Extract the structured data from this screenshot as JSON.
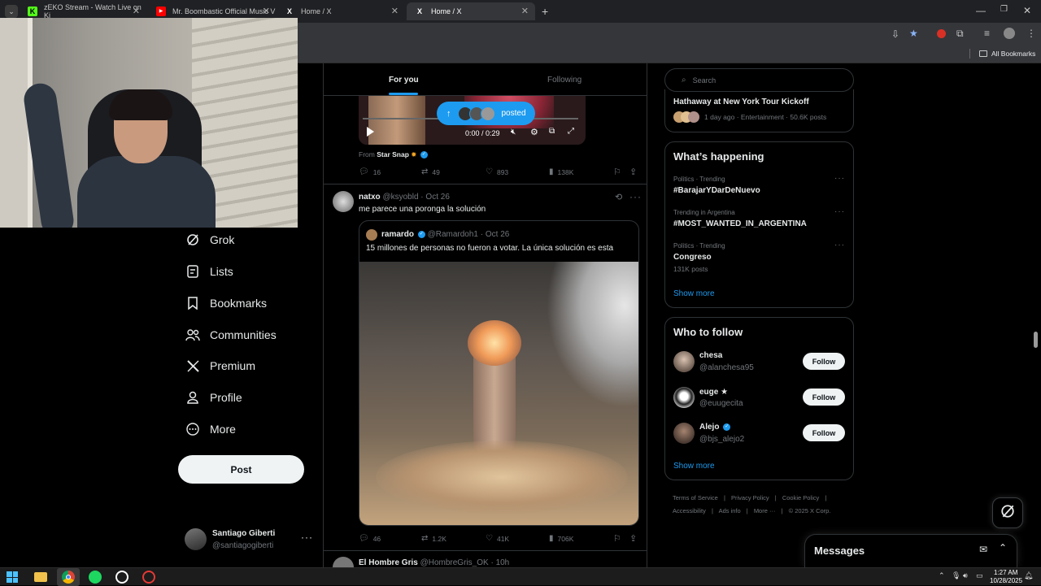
{
  "browser": {
    "tabs": [
      {
        "title": "zEKO Stream - Watch Live on Ki",
        "favicon": "K"
      },
      {
        "title": "Mr. Boombastic Official Music V",
        "favicon": "▶"
      },
      {
        "title": "Home / X",
        "favicon": "X"
      },
      {
        "title": "Home / X",
        "favicon": "X"
      }
    ],
    "all_bookmarks": "All Bookmarks"
  },
  "nav": {
    "items": [
      {
        "label": "Grok",
        "icon": "grok-icon"
      },
      {
        "label": "Lists",
        "icon": "lists-icon"
      },
      {
        "label": "Bookmarks",
        "icon": "bookmark-icon"
      },
      {
        "label": "Communities",
        "icon": "communities-icon"
      },
      {
        "label": "Premium",
        "icon": "x-logo-icon"
      },
      {
        "label": "Profile",
        "icon": "profile-icon"
      },
      {
        "label": "More",
        "icon": "more-circle-icon"
      }
    ],
    "post_label": "Post",
    "account": {
      "name": "Santiago Giberti",
      "handle": "@santiagogiberti"
    }
  },
  "feed": {
    "tabs": {
      "for_you": "For you",
      "following": "Following"
    },
    "posted_pill": "posted",
    "video_time": "0:00 / 0:29",
    "from_label": "From",
    "from_source": "Star Snap",
    "post1_metrics": {
      "replies": "16",
      "reposts": "49",
      "likes": "893",
      "views": "138K"
    },
    "post2": {
      "name": "natxo",
      "handle": "@ksyobld",
      "date": "Oct 26",
      "text": "me parece una poronga la solución",
      "quote": {
        "name": "ramardo",
        "handle": "@Ramardoh1",
        "date": "Oct 26",
        "text": "15 millones de personas no fueron a votar. La única solución es esta"
      },
      "metrics": {
        "replies": "46",
        "reposts": "1.2K",
        "likes": "41K",
        "views": "706K"
      }
    },
    "post3_name": "El Hombre Gris",
    "post3_handle": "@HombreGris_OK",
    "post3_date": "10h"
  },
  "right": {
    "search_placeholder": "Search",
    "event": {
      "title": "Hathaway at New York Tour Kickoff",
      "meta": "1 day ago · Entertainment · 50.6K posts"
    },
    "happening": {
      "title": "What’s happening",
      "trends": [
        {
          "context": "Politics · Trending",
          "name": "#BarajarYDarDeNuevo",
          "posts": ""
        },
        {
          "context": "Trending in Argentina",
          "name": "#MOST_WANTED_IN_ARGENTINA",
          "posts": ""
        },
        {
          "context": "Politics · Trending",
          "name": "Congreso",
          "posts": "131K posts"
        }
      ],
      "show_more": "Show more"
    },
    "who_to_follow": {
      "title": "Who to follow",
      "users": [
        {
          "name": "chesa",
          "handle": "@alanchesa95",
          "follow": "Follow"
        },
        {
          "name": "euge ★",
          "handle": "@euugecita",
          "follow": "Follow"
        },
        {
          "name": "Alejo",
          "handle": "@bjs_alejo2",
          "follow": "Follow"
        }
      ],
      "show_more": "Show more"
    },
    "footer": {
      "line1": [
        "Terms of Service",
        "Privacy Policy",
        "Cookie Policy"
      ],
      "line2": [
        "Accessibility",
        "Ads info",
        "More ···",
        "© 2025 X Corp."
      ]
    },
    "messages": "Messages"
  },
  "taskbar": {
    "time": "1:27 AM",
    "date": "10/28/2025"
  },
  "colors": {
    "accent": "#1d9bf0",
    "bg": "#000000",
    "border": "#2f3336",
    "muted": "#71767b"
  }
}
